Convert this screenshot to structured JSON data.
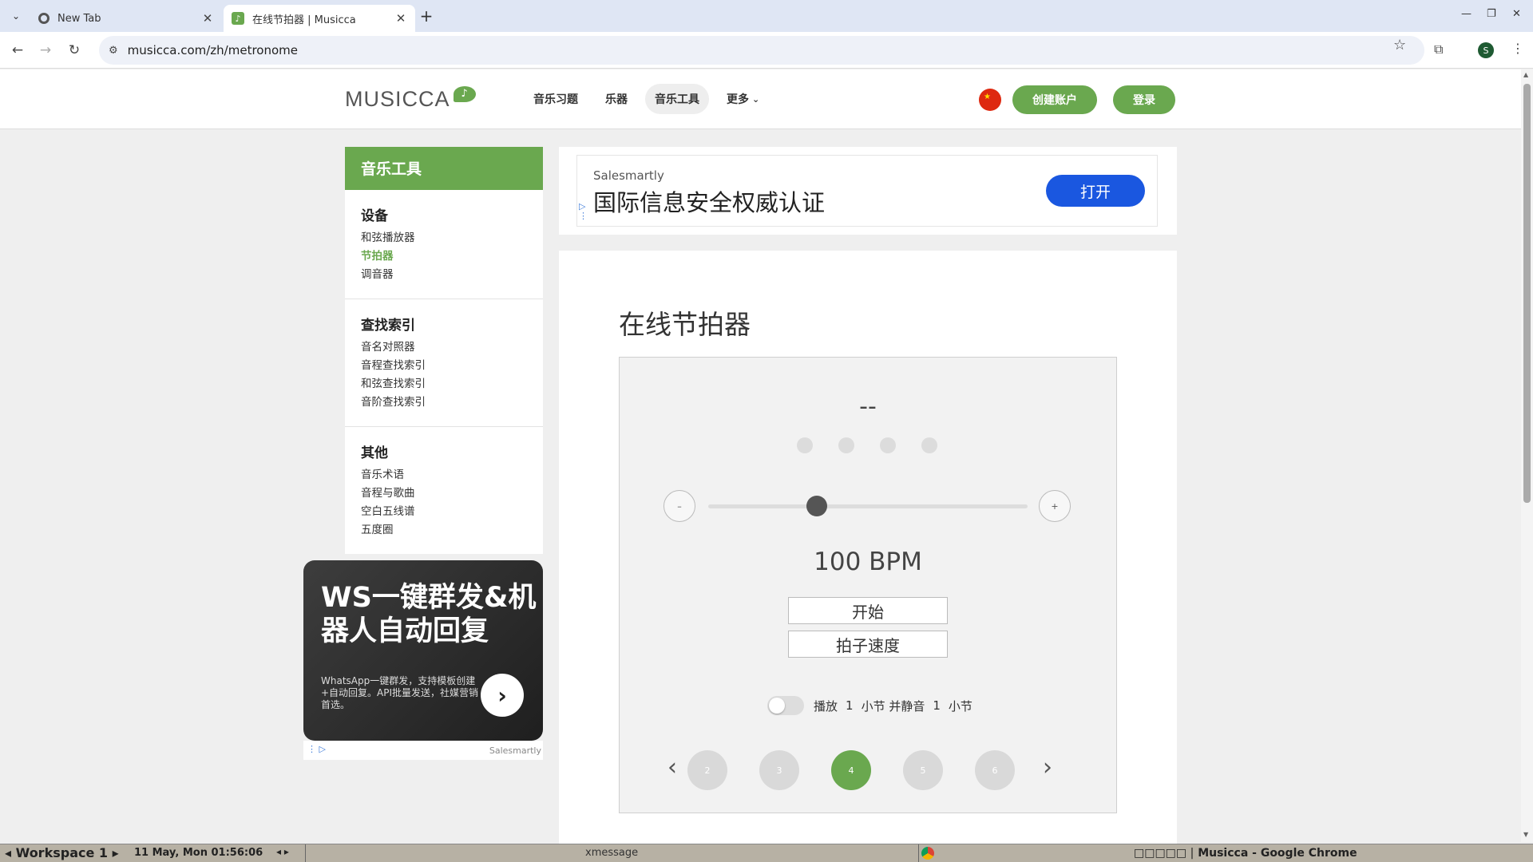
{
  "browser": {
    "tabs": [
      {
        "label": "New Tab",
        "active": false
      },
      {
        "label": "在线节拍器 | Musicca",
        "active": true
      }
    ],
    "new_tab_icon": "plus-icon",
    "url": "musicca.com/zh/metronome",
    "profile_initial": "S"
  },
  "site": {
    "logo": "MUSICCA",
    "nav": [
      {
        "label": "音乐习题",
        "active": false
      },
      {
        "label": "乐器",
        "active": false
      },
      {
        "label": "音乐工具",
        "active": true
      },
      {
        "label": "更多",
        "active": false
      }
    ],
    "create_account": "创建账户",
    "login": "登录",
    "accent_color": "#6aa84f"
  },
  "sidebar": {
    "title": "音乐工具",
    "groups": [
      {
        "title": "设备",
        "links": [
          "和弦播放器",
          "节拍器",
          "调音器"
        ],
        "active_index": 1
      },
      {
        "title": "查找索引",
        "links": [
          "音名对照器",
          "音程查找索引",
          "和弦查找索引",
          "音阶查找索引"
        ]
      },
      {
        "title": "其他",
        "links": [
          "音乐术语",
          "音程与歌曲",
          "空白五线谱",
          "五度圈"
        ]
      }
    ]
  },
  "side_ad": {
    "headline": "WS一键群发&机器人自动回复",
    "body": "WhatsApp一键群发，支持模板创建+自动回复。API批量发送，社媒营销首选。",
    "brand": "Salesmartly"
  },
  "top_ad": {
    "brand": "Salesmartly",
    "title": "国际信息安全权威认证",
    "button": "打开",
    "button_color": "#1a57e0"
  },
  "metronome": {
    "page_title": "在线节拍器",
    "beat_display": "--",
    "beats_per_bar": 4,
    "minus_label": "–",
    "plus_label": "+",
    "bpm_value": 100,
    "bpm_text": "100 BPM",
    "slider_fraction": 0.34,
    "start_button": "开始",
    "tap_button": "拍子速度",
    "mute": {
      "play_label": "播放",
      "play_bars": "1",
      "mid_label": "小节 并静音",
      "mute_bars": "1",
      "end_label": "小节",
      "enabled": false
    },
    "beat_pages": [
      "2",
      "3",
      "4",
      "5",
      "6"
    ],
    "active_beat": "4"
  },
  "taskbar": {
    "workspace": "Workspace 1",
    "clock": "11 May, Mon 01:56:06",
    "center": "xmessage",
    "window_title_prefix": "□□□□□ |",
    "window_title": "Musicca - Google Chrome"
  }
}
